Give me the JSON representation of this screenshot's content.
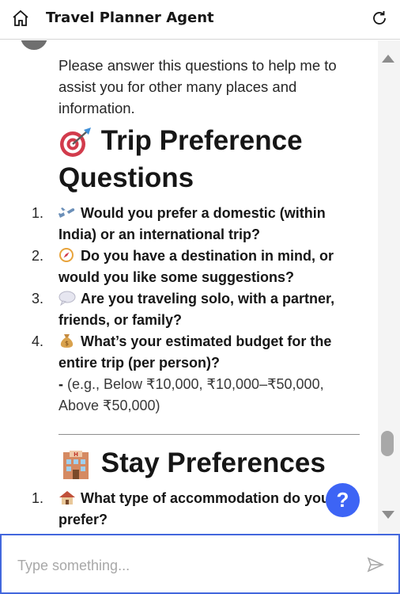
{
  "header": {
    "title": "Travel Planner Agent",
    "home_icon": "home-icon",
    "refresh_icon": "refresh-icon"
  },
  "message": {
    "intro": "Please answer this questions to help me to assist you for other many places and information.",
    "section1": {
      "emoji": "dart-target-icon",
      "title": "Trip Preference Questions",
      "items": [
        {
          "num": "1.",
          "icon": "airplane-icon",
          "text": "Would you prefer a domestic (within India) or an international trip?"
        },
        {
          "num": "2.",
          "icon": "compass-icon",
          "text": "Do you have a destination in mind, or would you like some suggestions?"
        },
        {
          "num": "3.",
          "icon": "speech-bubble-icon",
          "text": "Are you traveling solo, with a partner, friends, or family?"
        },
        {
          "num": "4.",
          "icon": "money-bag-icon",
          "text": "What’s your estimated budget for the entire trip (per person)?"
        }
      ],
      "budget_note_dash": "-",
      "budget_note": " (e.g., Below ₹10,000, ₹10,000–₹50,000, Above ₹50,000)"
    },
    "section2": {
      "emoji": "hotel-icon",
      "title": "Stay Preferences",
      "items": [
        {
          "num": "1.",
          "icon": "house-icon",
          "text": "What type of accommodation do you prefer?"
        }
      ]
    }
  },
  "help_button": {
    "label": "?"
  },
  "composer": {
    "placeholder": "Type something...",
    "send_icon": "send-icon"
  },
  "colors": {
    "accent": "#3d64f5",
    "border_focus": "#4367dd"
  }
}
